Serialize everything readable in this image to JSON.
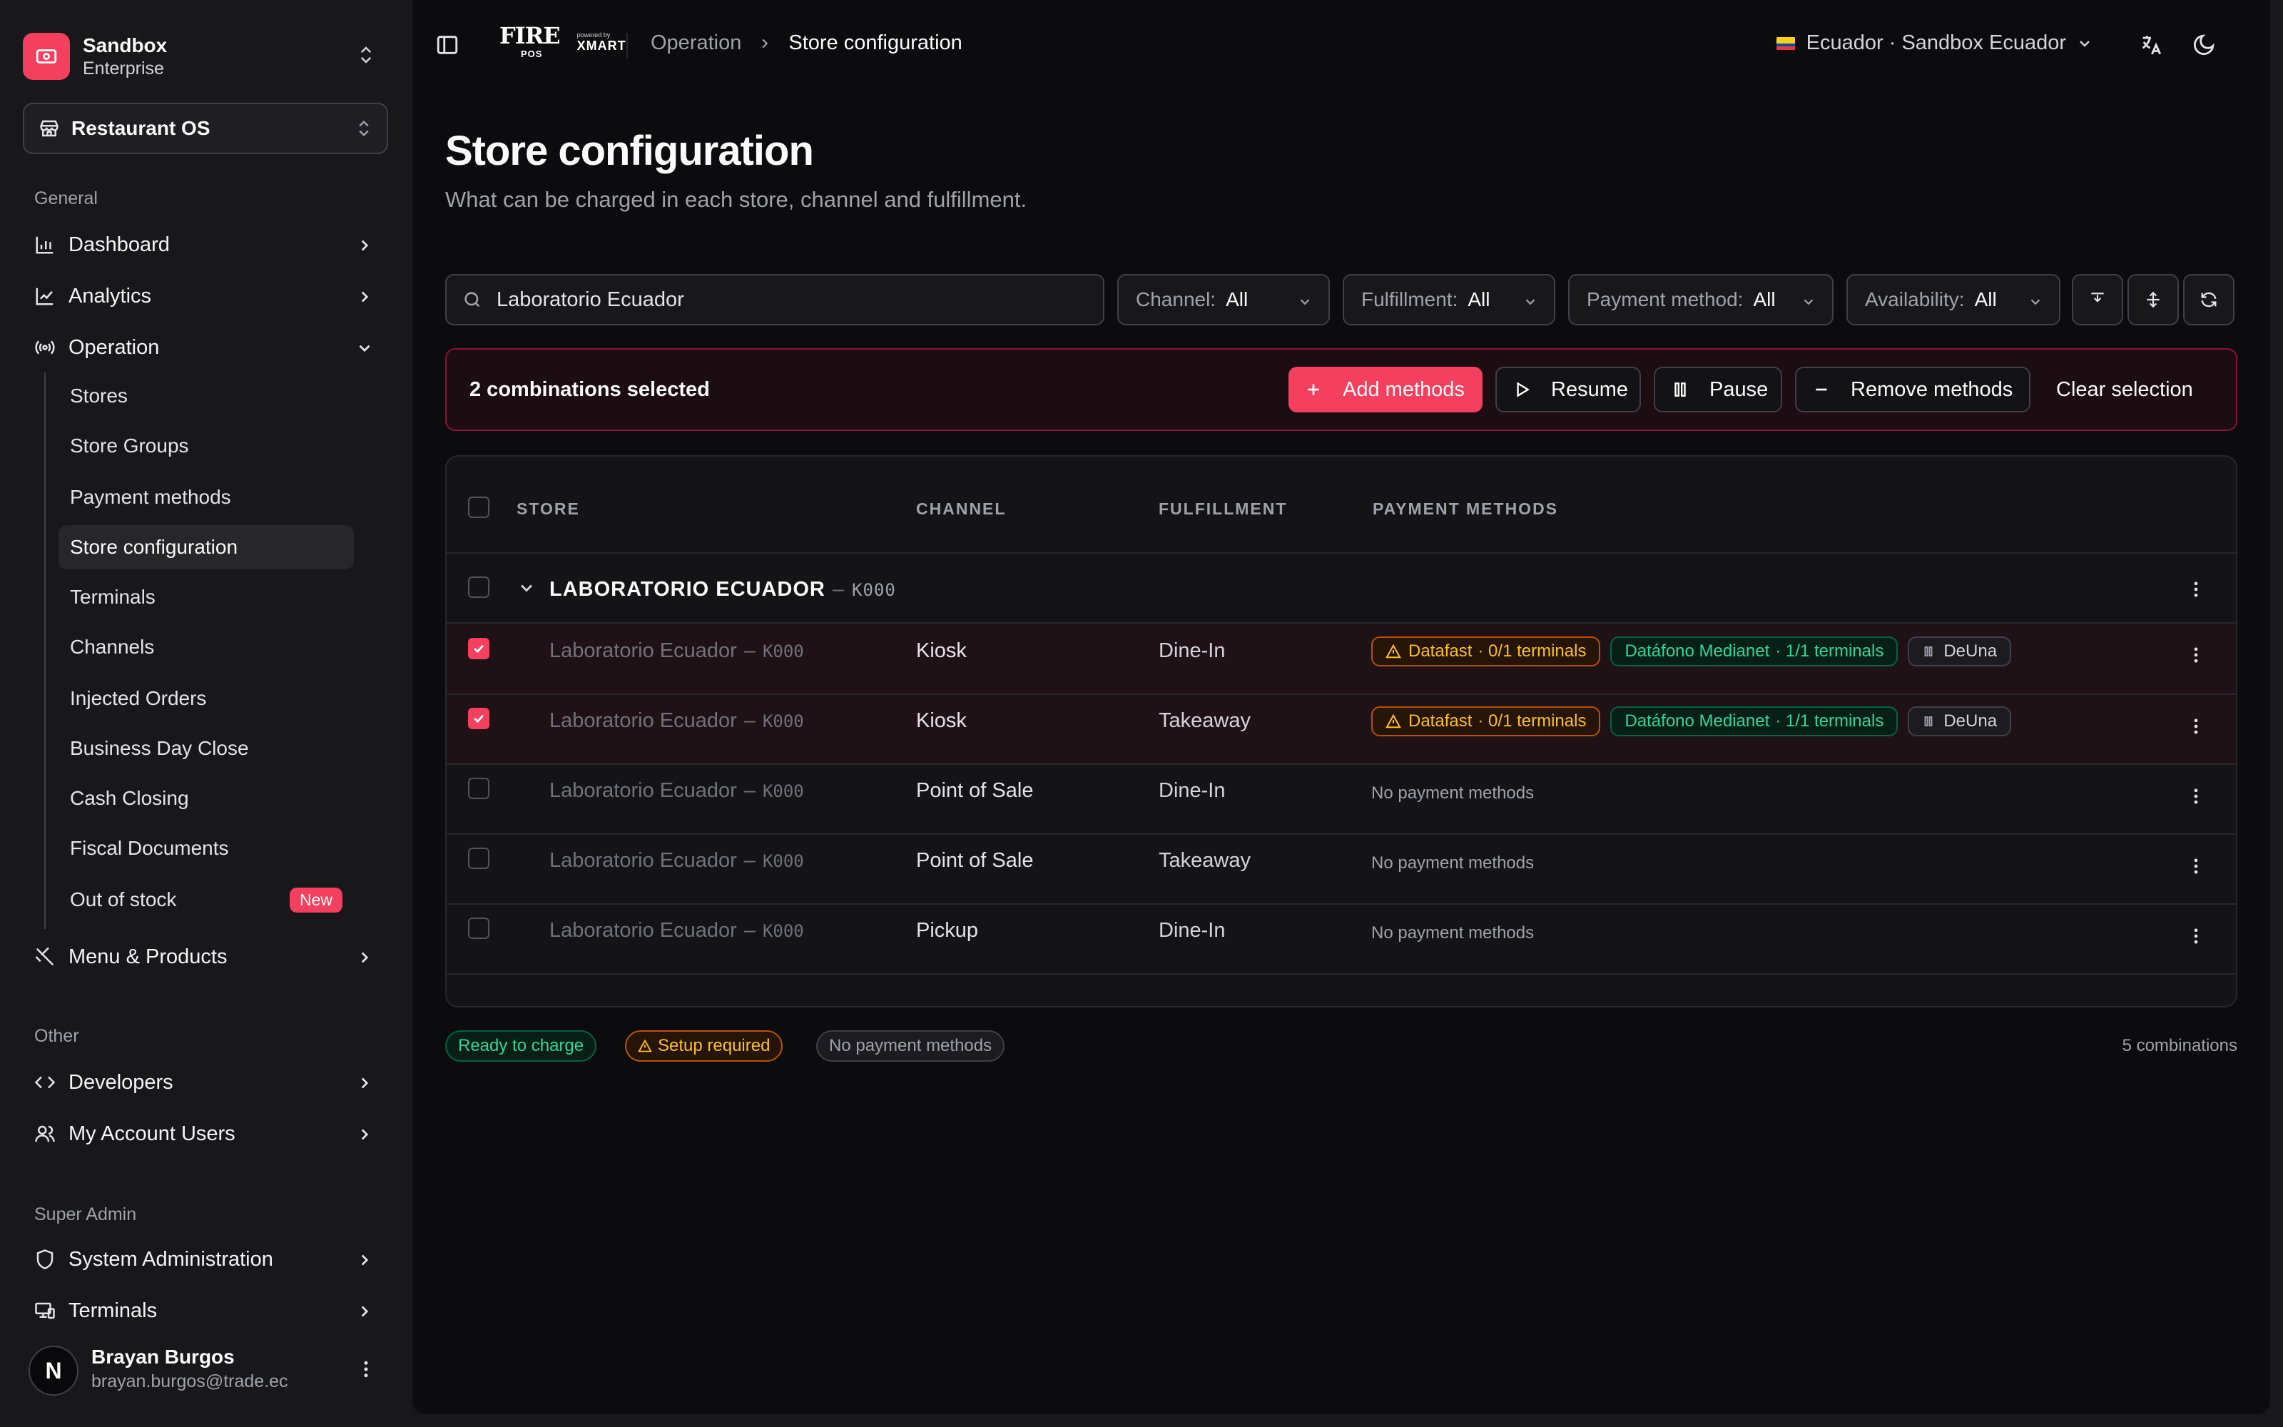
{
  "sidebar": {
    "org": {
      "name": "Sandbox",
      "plan": "Enterprise"
    },
    "product": "Restaurant OS",
    "sections": {
      "general": "General",
      "other": "Other",
      "super_admin": "Super Admin"
    },
    "items": {
      "dashboard": "Dashboard",
      "analytics": "Analytics",
      "operation": "Operation",
      "menu_products": "Menu & Products",
      "developers": "Developers",
      "account_users": "My Account Users",
      "system_admin": "System Administration",
      "terminals_admin": "Terminals"
    },
    "operation_sub": {
      "stores": "Stores",
      "store_groups": "Store Groups",
      "payment_methods": "Payment methods",
      "store_configuration": "Store configuration",
      "terminals": "Terminals",
      "channels": "Channels",
      "injected_orders": "Injected Orders",
      "business_day_close": "Business Day Close",
      "cash_closing": "Cash Closing",
      "fiscal_documents": "Fiscal Documents",
      "out_of_stock": "Out of stock",
      "new_badge": "New"
    },
    "user": {
      "name": "Brayan Burgos",
      "email": "brayan.burgos@trade.ec",
      "initial": "N"
    }
  },
  "topbar": {
    "brand_fire": "FIRE",
    "brand_pos": "POS",
    "brand_powered": "powered by",
    "brand_xmart": "XMART",
    "breadcrumb": [
      "Operation",
      "Store configuration"
    ],
    "country": "Ecuador · Sandbox Ecuador"
  },
  "page": {
    "title": "Store configuration",
    "subtitle": "What can be charged in each store, channel and fulfillment."
  },
  "filters": {
    "search_value": "Laboratorio Ecuador",
    "channel": {
      "label": "Channel:",
      "value": "All"
    },
    "fulfillment": {
      "label": "Fulfillment:",
      "value": "All"
    },
    "payment": {
      "label": "Payment method:",
      "value": "All"
    },
    "availability": {
      "label": "Availability:",
      "value": "All"
    }
  },
  "selection": {
    "count_text": "2 combinations selected",
    "add": "Add methods",
    "resume": "Resume",
    "pause": "Pause",
    "remove": "Remove methods",
    "clear": "Clear selection"
  },
  "table": {
    "headers": {
      "store": "STORE",
      "channel": "CHANNEL",
      "fulfillment": "FULFILLMENT",
      "payment": "PAYMENT METHODS"
    },
    "group": {
      "name": "LABORATORIO ECUADOR",
      "dash": "–",
      "code": "K000"
    },
    "rows": [
      {
        "store": "Laboratorio Ecuador",
        "dash": "–",
        "code": "K000",
        "channel": "Kiosk",
        "fulfillment": "Dine-In",
        "selected": true,
        "pm1": {
          "name": "Datafast",
          "detail": "· 0/1 terminals"
        },
        "pm2": {
          "name": "Datáfono Medianet",
          "detail": "· 1/1 terminals"
        },
        "pm3": {
          "name": "DeUna"
        }
      },
      {
        "store": "Laboratorio Ecuador",
        "dash": "–",
        "code": "K000",
        "channel": "Kiosk",
        "fulfillment": "Takeaway",
        "selected": true,
        "pm1": {
          "name": "Datafast",
          "detail": "· 0/1 terminals"
        },
        "pm2": {
          "name": "Datáfono Medianet",
          "detail": "· 1/1 terminals"
        },
        "pm3": {
          "name": "DeUna"
        }
      },
      {
        "store": "Laboratorio Ecuador",
        "dash": "–",
        "code": "K000",
        "channel": "Point of Sale",
        "fulfillment": "Dine-In",
        "selected": false,
        "none": "No payment methods"
      },
      {
        "store": "Laboratorio Ecuador",
        "dash": "–",
        "code": "K000",
        "channel": "Point of Sale",
        "fulfillment": "Takeaway",
        "selected": false,
        "none": "No payment methods"
      },
      {
        "store": "Laboratorio Ecuador",
        "dash": "–",
        "code": "K000",
        "channel": "Pickup",
        "fulfillment": "Dine-In",
        "selected": false,
        "none": "No payment methods"
      }
    ]
  },
  "legend": {
    "ready": "Ready to charge",
    "setup": "Setup required",
    "none": "No payment methods"
  },
  "footer": {
    "total": "5 combinations"
  },
  "colors": {
    "accent": "#f43f5e",
    "ok": "#34d399",
    "warn": "#fbbf24"
  }
}
